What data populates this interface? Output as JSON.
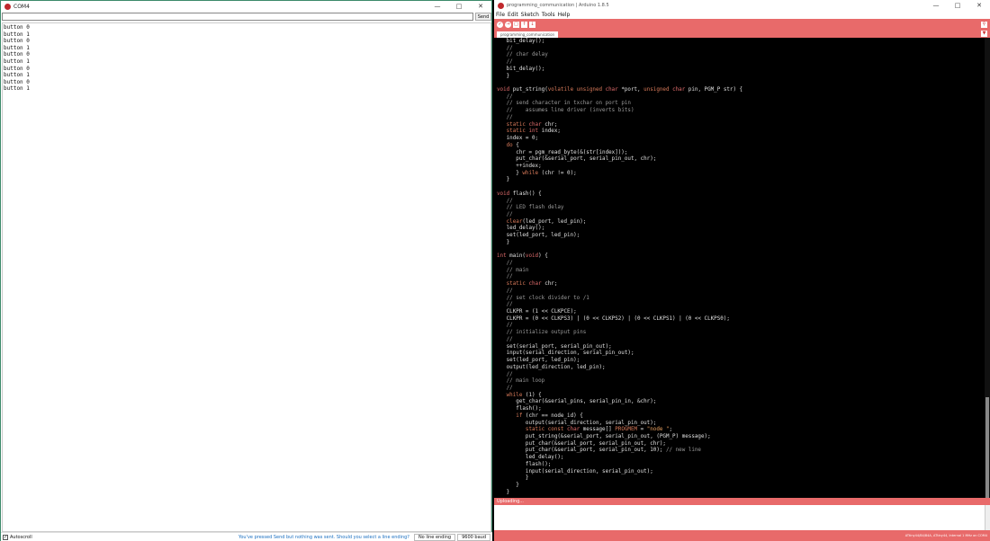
{
  "serial_monitor": {
    "title": "COM4",
    "send_label": "Send",
    "input_value": "",
    "lines": [
      "button 0",
      "button 1",
      "button 0",
      "button 1",
      "button 0",
      "button 1",
      "button 0",
      "button 1",
      "button 0",
      "button 1"
    ],
    "autoscroll_label": "Autoscroll",
    "line_ending_message": "You've pressed Send but nothing was sent. Should you select a line ending?",
    "line_ending": "No line ending",
    "baud": "9600 baud"
  },
  "ide": {
    "title": "programming_communication | Arduino 1.8.5",
    "menu": [
      "File",
      "Edit",
      "Sketch",
      "Tools",
      "Help"
    ],
    "tab_label": "programming_communication",
    "status": "Uploading...",
    "footer_text": "ATtiny44/84/84A, ATtiny44, Internal 1 MHz on COM4",
    "code": [
      "   bit_delay();",
      "   //",
      "   // char delay",
      "   //",
      "   bit_delay();",
      "   }",
      "",
      "void put_string(volatile unsigned char *port, unsigned char pin, PGM_P str) {",
      "   //",
      "   // send character in txchar on port pin",
      "   //    assumes line driver (inverts bits)",
      "   //",
      "   static char chr;",
      "   static int index;",
      "   index = 0;",
      "   do {",
      "      chr = pgm_read_byte(&(str[index]));",
      "      put_char(&serial_port, serial_pin_out, chr);",
      "      ++index;",
      "      } while (chr != 0);",
      "   }",
      "",
      "void flash() {",
      "   //",
      "   // LED flash delay",
      "   //",
      "   clear(led_port, led_pin);",
      "   led_delay();",
      "   set(led_port, led_pin);",
      "   }",
      "",
      "int main(void) {",
      "   //",
      "   // main",
      "   //",
      "   static char chr;",
      "   //",
      "   // set clock divider to /1",
      "   //",
      "   CLKPR = (1 << CLKPCE);",
      "   CLKPR = (0 << CLKPS3) | (0 << CLKPS2) | (0 << CLKPS1) | (0 << CLKPS0);",
      "   //",
      "   // initialize output pins",
      "   //",
      "   set(serial_port, serial_pin_out);",
      "   input(serial_direction, serial_pin_out);",
      "   set(led_port, led_pin);",
      "   output(led_direction, led_pin);",
      "   //",
      "   // main loop",
      "   //",
      "   while (1) {",
      "      get_char(&serial_pins, serial_pin_in, &chr);",
      "      flash();",
      "      if (chr == node_id) {",
      "         output(serial_direction, serial_pin_out);",
      "         static const char message[] PROGMEM = \"node \";",
      "         put_string(&serial_port, serial_pin_out, (PGM_P) message);",
      "         put_char(&serial_port, serial_pin_out, chr);",
      "         put_char(&serial_port, serial_pin_out, 10); // new line",
      "         led_delay();",
      "         flash();",
      "         input(serial_direction, serial_pin_out);",
      "         }",
      "      }",
      "   }"
    ]
  }
}
